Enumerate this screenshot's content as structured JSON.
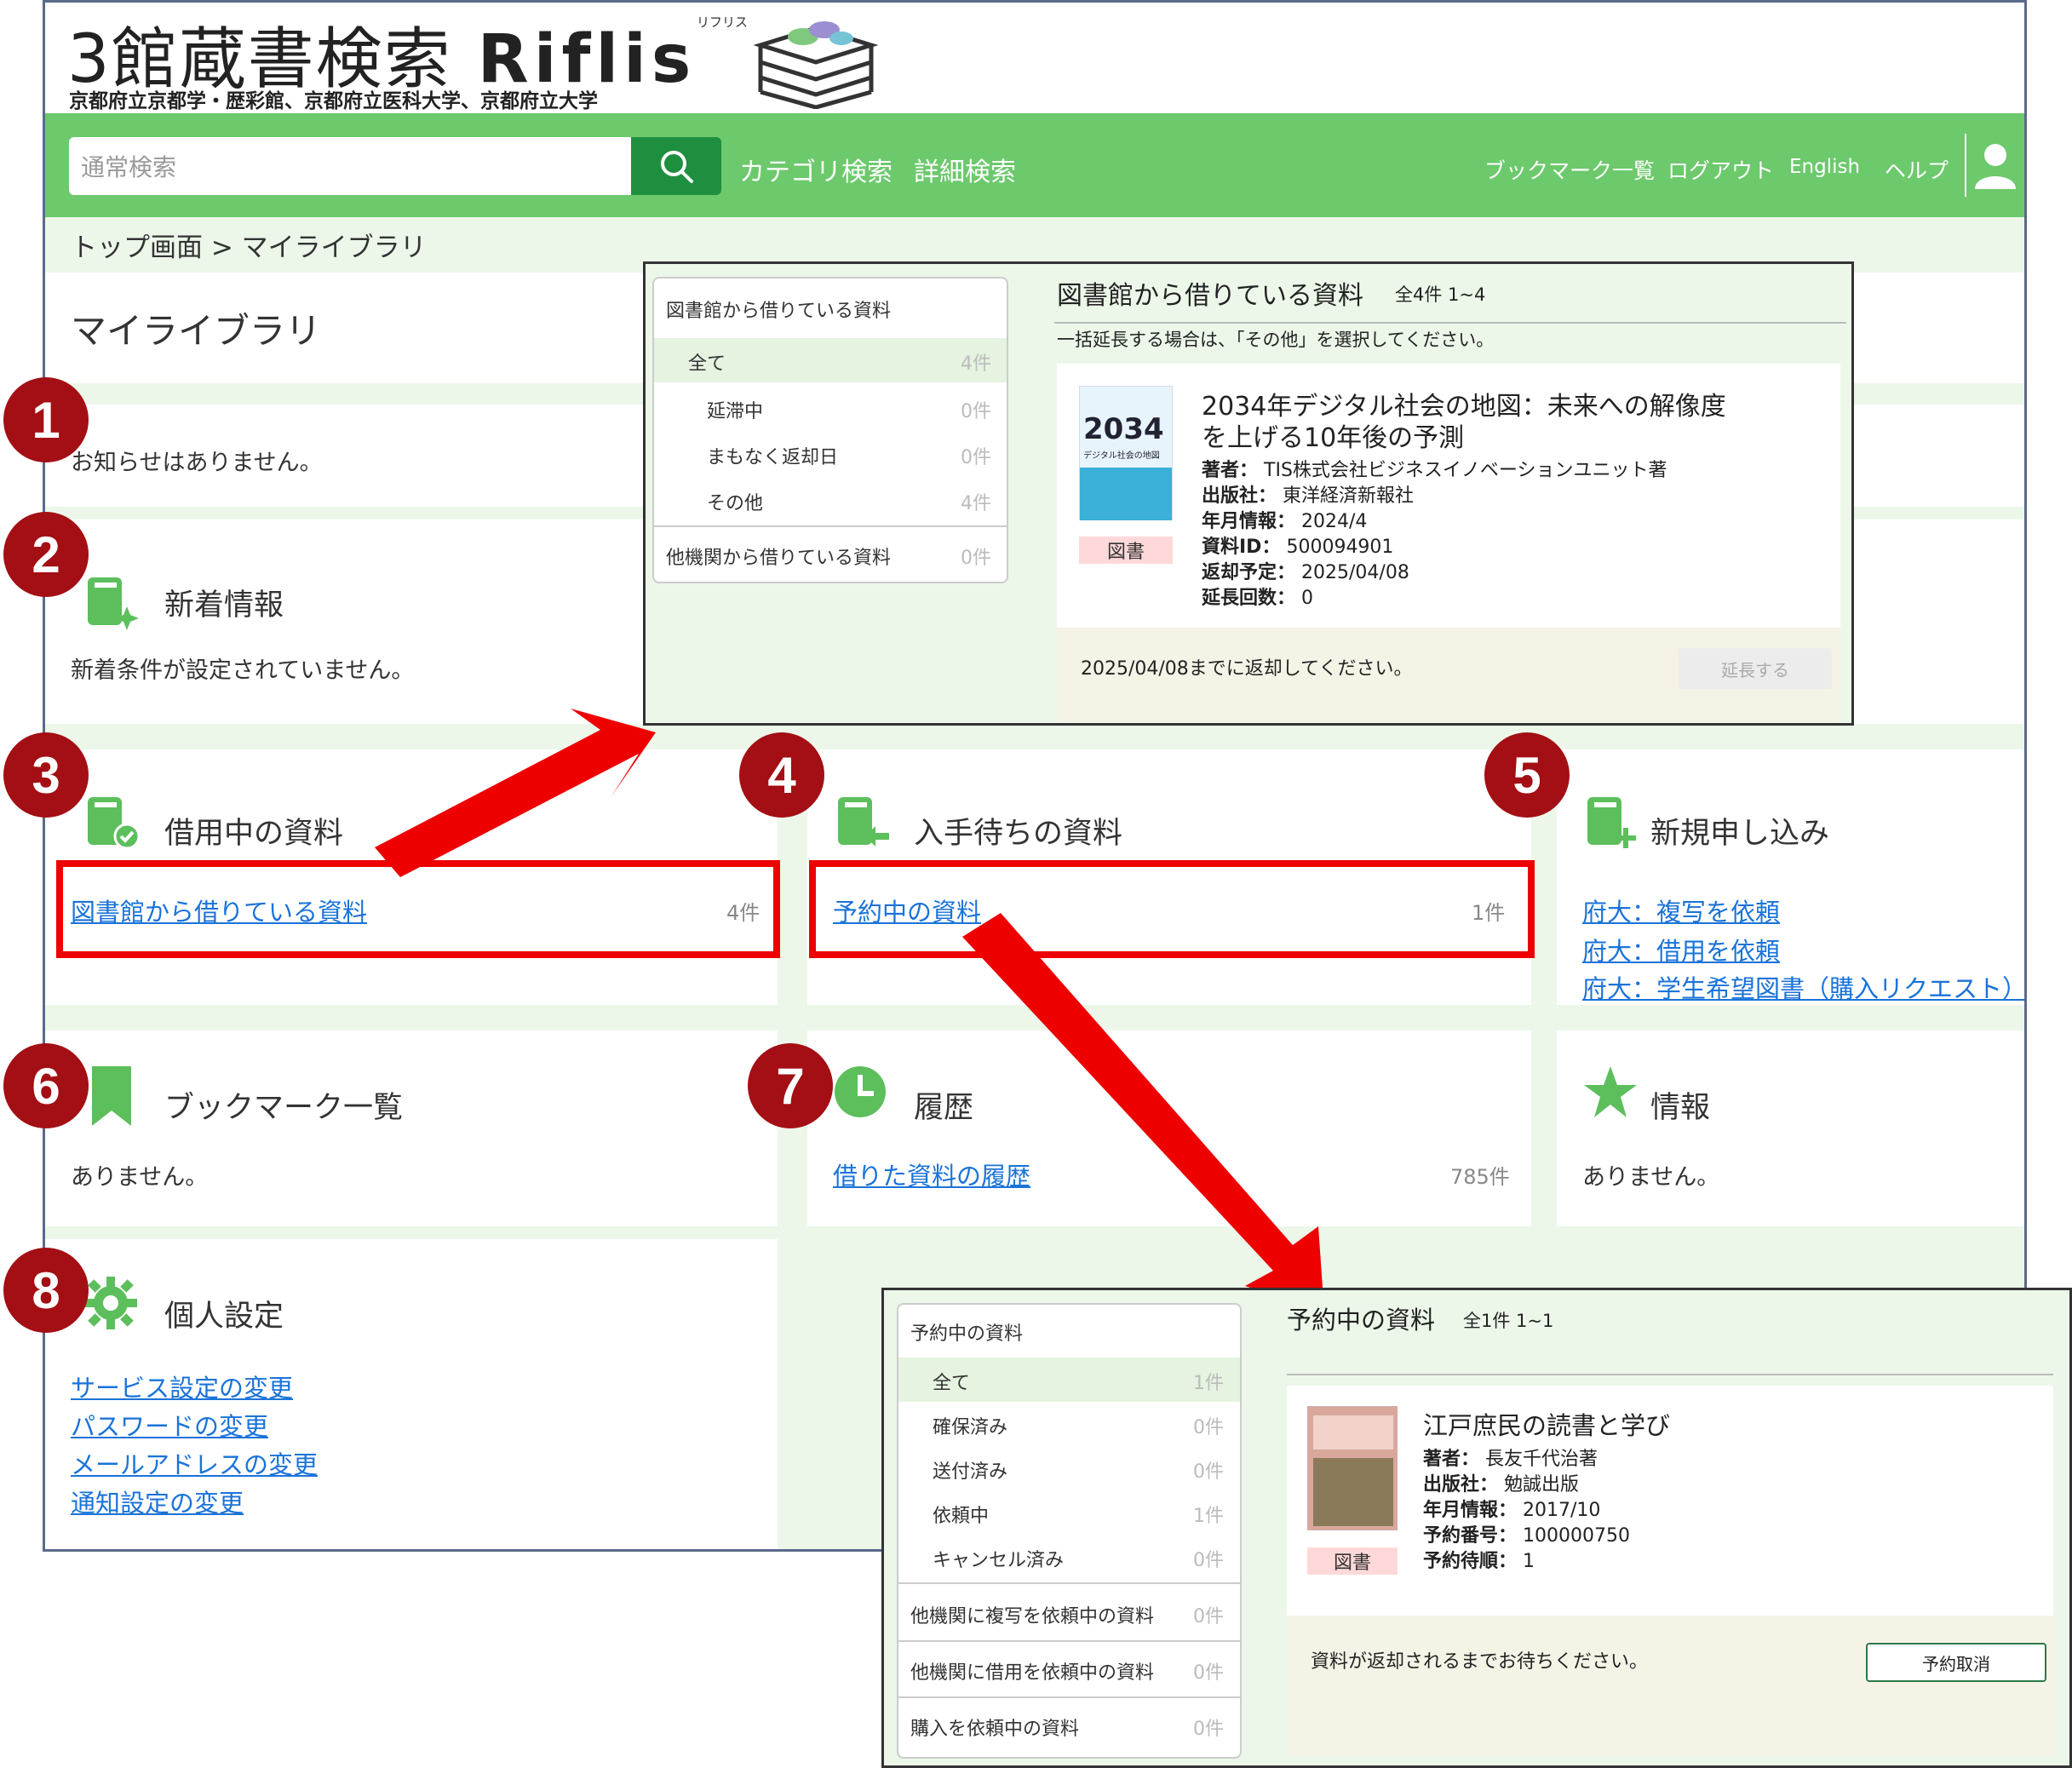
{
  "header": {
    "title_main": "3館蔵書検索",
    "brand": "Riflis",
    "brand_ruby": "リフリス",
    "subtitle": "京都府立京都学・歴彩館、京都府立医科大学、京都府立大学"
  },
  "nav": {
    "search_placeholder": "通常検索",
    "search_icon": "search-icon",
    "category_search": "カテゴリ検索",
    "advanced_search": "詳細検索",
    "bookmarks": "ブックマーク一覧",
    "logout": "ログアウト",
    "english": "English",
    "help": "ヘルプ",
    "user_icon": "user-icon"
  },
  "breadcrumb": "トップ画面 > マイライブラリ",
  "page_title": "マイライブラリ",
  "notice": "お知らせはありません。",
  "cards": {
    "new_arrivals": {
      "title": "新着情報",
      "text": "新着条件が設定されていません。"
    },
    "borrowing": {
      "title": "借用中の資料",
      "link": "図書館から借りている資料",
      "count": "4件"
    },
    "waiting": {
      "title": "入手待ちの資料",
      "link": "予約中の資料",
      "count": "1件"
    },
    "new_request": {
      "title": "新規申し込み",
      "links": [
        "府大：複写を依頼",
        "府大：借用を依頼",
        "府大：学生希望図書（購入リクエスト）"
      ]
    },
    "bookmarks": {
      "title": "ブックマーク一覧",
      "text": "ありません。"
    },
    "history": {
      "title": "履歴",
      "link": "借りた資料の履歴",
      "count": "785件"
    },
    "info": {
      "title": "情報",
      "text": "ありません。"
    },
    "settings": {
      "title": "個人設定",
      "links": [
        "サービス設定の変更",
        "パスワードの変更",
        "メールアドレスの変更",
        "通知設定の変更"
      ]
    }
  },
  "callouts": [
    "1",
    "2",
    "3",
    "4",
    "5",
    "6",
    "7",
    "8"
  ],
  "popup_borrowed": {
    "menu_title": "図書館から借りている資料",
    "menu_items": [
      {
        "label": "全て",
        "count": "4件"
      },
      {
        "label": "延滞中",
        "count": "0件"
      },
      {
        "label": "まもなく返却日",
        "count": "0件"
      },
      {
        "label": "その他",
        "count": "4件"
      }
    ],
    "menu_other": {
      "label": "他機関から借りている資料",
      "count": "0件"
    },
    "heading": "図書館から借りている資料",
    "heading_count": "全4件 1~4",
    "note": "一括延長する場合は、「その他」を選択してください。",
    "book_title_line1": "2034年デジタル社会の地図：未来への解像度",
    "book_title_line2": "を上げる10年後の予測",
    "cover_text": "2034",
    "cover_sub": "デジタル社会の地図",
    "fields": [
      {
        "k": "著者：",
        "v": "TIS株式会社ビジネスイノベーションユニット著"
      },
      {
        "k": "出版社：",
        "v": "東洋経済新報社"
      },
      {
        "k": "年月情報：",
        "v": "2024/4"
      },
      {
        "k": "資料ID：",
        "v": "500094901"
      },
      {
        "k": "返却予定：",
        "v": "2025/04/08"
      },
      {
        "k": "延長回数：",
        "v": "0"
      }
    ],
    "badge": "図書",
    "footer_note": "2025/04/08までに返却してください。",
    "extend_button": "延長する"
  },
  "popup_reserved": {
    "menu_title": "予約中の資料",
    "menu_items": [
      {
        "label": "全て",
        "count": "1件"
      },
      {
        "label": "確保済み",
        "count": "0件"
      },
      {
        "label": "送付済み",
        "count": "0件"
      },
      {
        "label": "依頼中",
        "count": "1件"
      },
      {
        "label": "キャンセル済み",
        "count": "0件"
      }
    ],
    "menu_others": [
      {
        "label": "他機関に複写を依頼中の資料",
        "count": "0件"
      },
      {
        "label": "他機関に借用を依頼中の資料",
        "count": "0件"
      },
      {
        "label": "購入を依頼中の資料",
        "count": "0件"
      }
    ],
    "heading": "予約中の資料",
    "heading_count": "全1件 1~1",
    "book_title": "江戸庶民の読書と学び",
    "fields": [
      {
        "k": "著者：",
        "v": "長友千代治著"
      },
      {
        "k": "出版社：",
        "v": "勉誠出版"
      },
      {
        "k": "年月情報：",
        "v": "2017/10"
      },
      {
        "k": "予約番号：",
        "v": "100000750"
      },
      {
        "k": "予約待順：",
        "v": "1"
      }
    ],
    "badge": "図書",
    "footer_note": "資料が返却されるまでお待ちください。",
    "cancel_button": "予約取消"
  },
  "colors": {
    "nav_green": "#6cc96c",
    "button_green": "#1e8f3e",
    "link_blue": "#1a73d9",
    "callout_red": "#a30f14",
    "highlight_red": "#ee0000"
  }
}
